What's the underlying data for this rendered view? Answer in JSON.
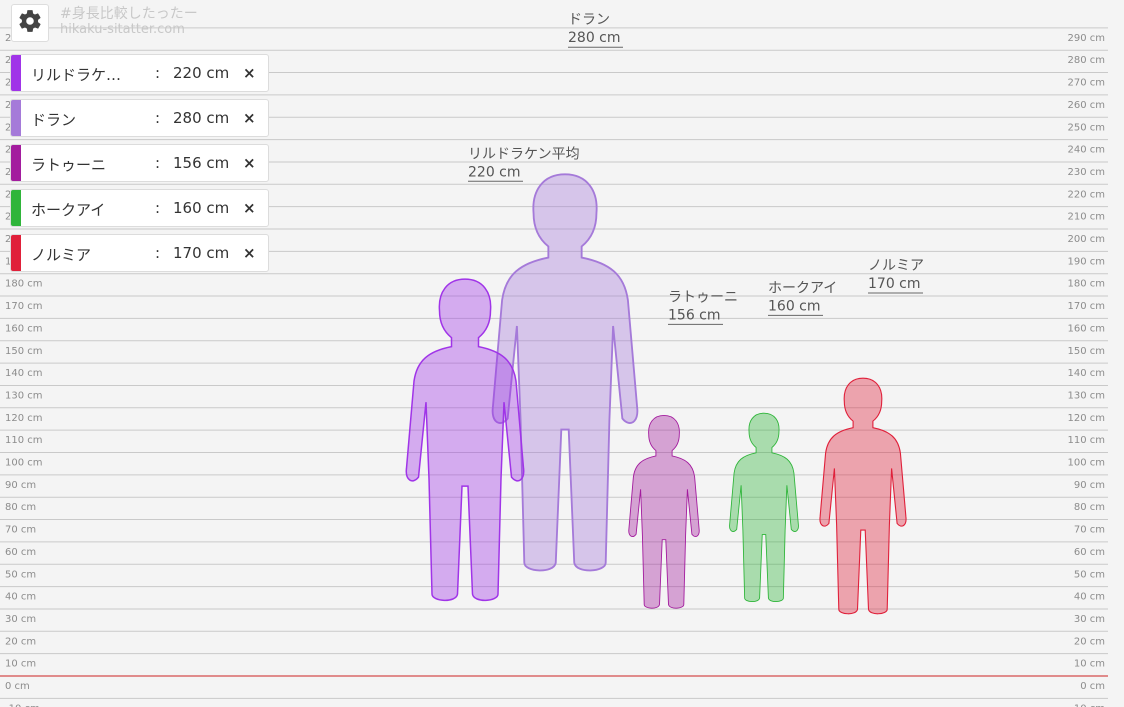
{
  "app": {
    "watermark_title": "#身長比較したったー",
    "watermark_url": "hikaku-sitatter.com"
  },
  "icons": {
    "settings": "gear-icon",
    "remove": "close-icon"
  },
  "scale": {
    "unit": "cm",
    "min": -10,
    "max": 290,
    "step": 10,
    "baseline": 0,
    "baseline_color": "#cc2222"
  },
  "characters": [
    {
      "name": "リルドラケ…",
      "full_name": "リルドラケン平均",
      "height": 220,
      "height_label": "220 cm",
      "color": "#a034e8"
    },
    {
      "name": "ドラン",
      "full_name": "ドラン",
      "height": 280,
      "height_label": "280 cm",
      "color": "#a57ad9"
    },
    {
      "name": "ラトゥーニ",
      "full_name": "ラトゥーニ",
      "height": 156,
      "height_label": "156 cm",
      "color": "#a31c9e"
    },
    {
      "name": "ホークアイ",
      "full_name": "ホークアイ",
      "height": 160,
      "height_label": "160 cm",
      "color": "#2fb53a"
    },
    {
      "name": "ノルミア",
      "full_name": "ノルミア",
      "height": 170,
      "height_label": "170 cm",
      "color": "#e0203a"
    }
  ],
  "list_separator": ":",
  "remove_symbol": "×"
}
